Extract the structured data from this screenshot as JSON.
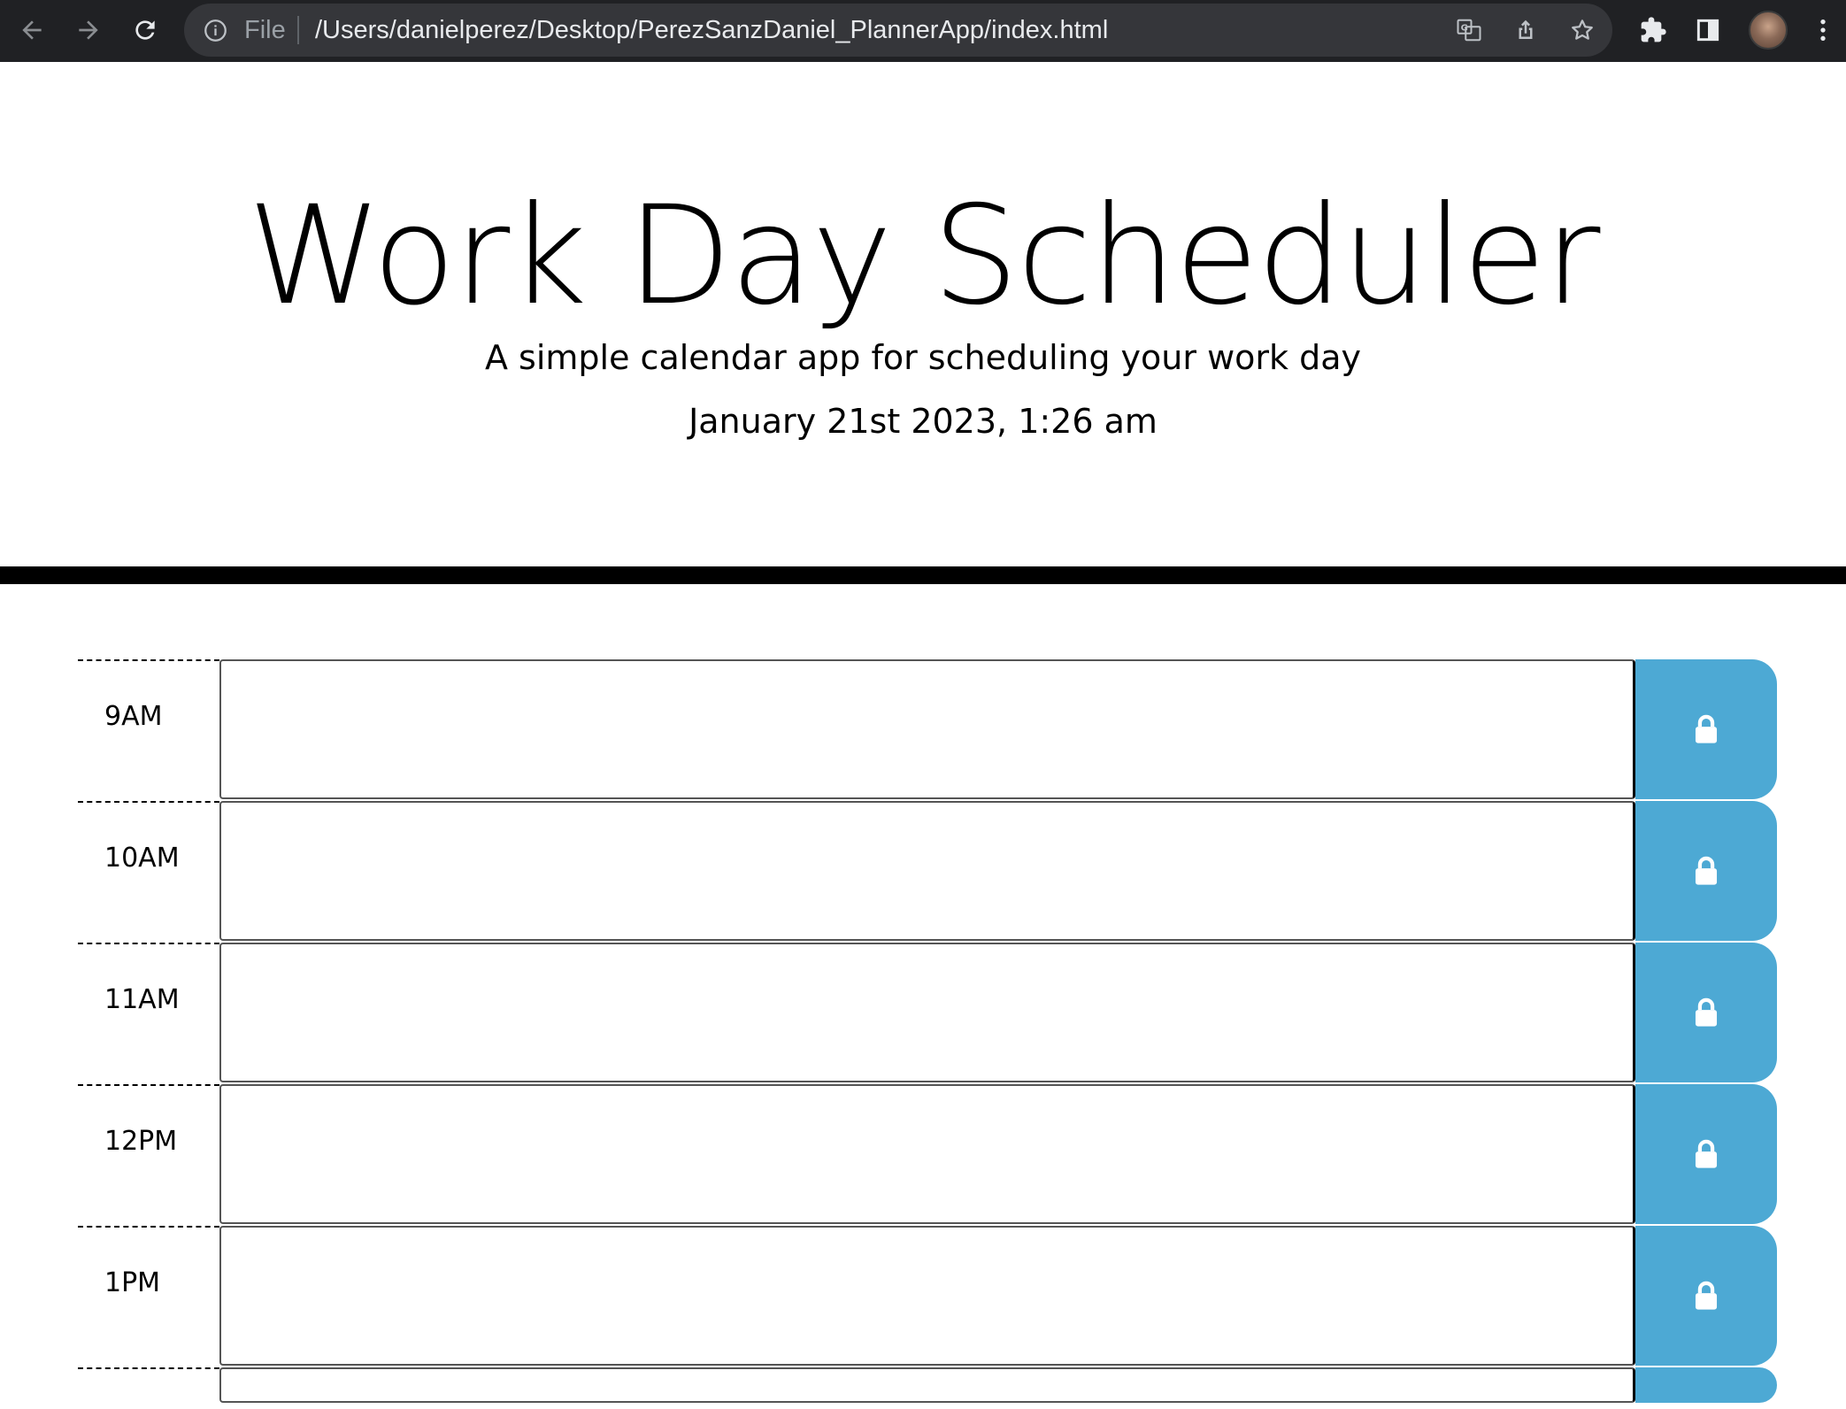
{
  "browser": {
    "url_scheme_label": "File",
    "url": "/Users/danielperez/Desktop/PerezSanzDaniel_PlannerApp/index.html"
  },
  "header": {
    "title": "Work Day Scheduler",
    "subtitle": "A simple calendar app for scheduling your work day",
    "current_day": "January 21st 2023, 1:26 am"
  },
  "time_blocks": [
    {
      "hour": "9AM",
      "text": ""
    },
    {
      "hour": "10AM",
      "text": ""
    },
    {
      "hour": "11AM",
      "text": ""
    },
    {
      "hour": "12PM",
      "text": ""
    },
    {
      "hour": "1PM",
      "text": ""
    }
  ],
  "colors": {
    "save_button": "#4da9d4",
    "chrome_bg": "#202124",
    "omnibox_bg": "#35363a",
    "divider": "#000000"
  },
  "icons": {
    "save": "lock-icon"
  }
}
